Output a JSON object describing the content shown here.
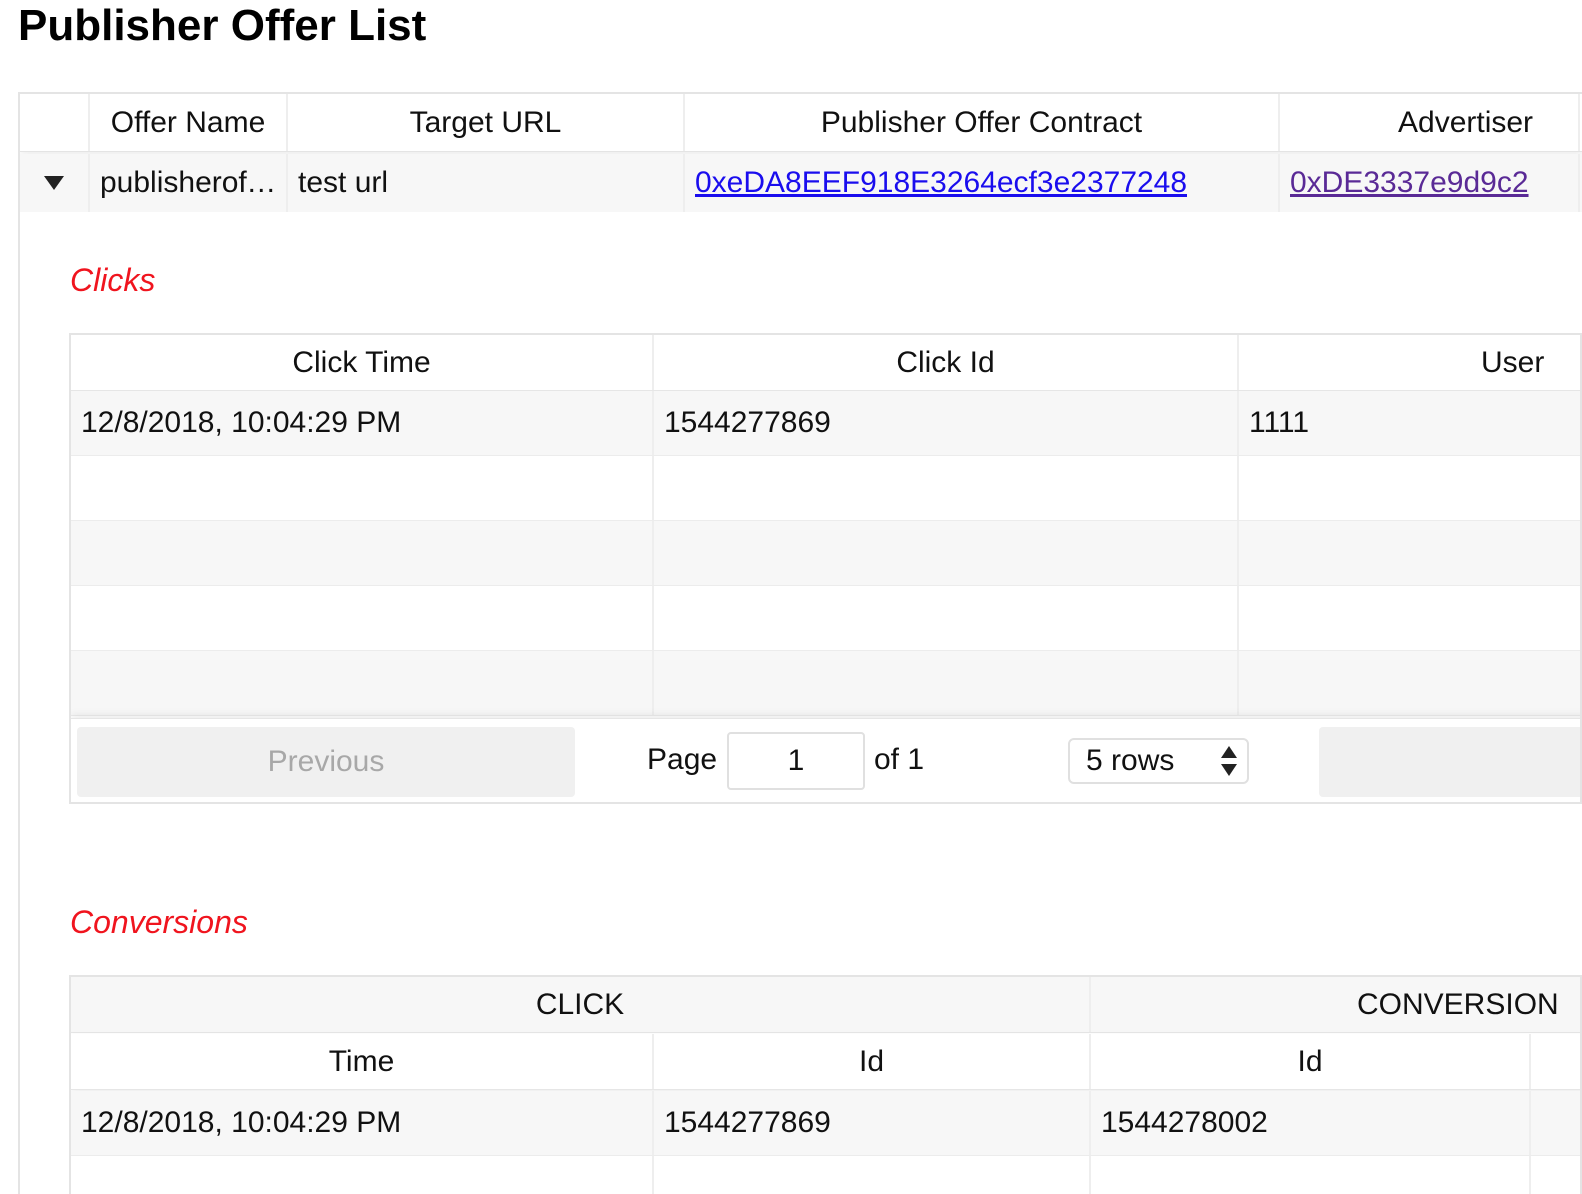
{
  "page": {
    "title": "Publisher Offer List"
  },
  "offers_table": {
    "columns": [
      "",
      "Offer Name",
      "Target URL",
      "Publisher Offer Contract",
      "Advertiser"
    ],
    "rows": [
      {
        "offer_name": "publisheroffer",
        "target_url": "test url",
        "contract": "0xeDA8EEF918E3264ecf3e2377248",
        "advertiser": "0xDE3337e9d9c2"
      }
    ]
  },
  "clicks": {
    "section_title": "Clicks",
    "columns": [
      "Click Time",
      "Click Id",
      "User"
    ],
    "rows": [
      {
        "time": "12/8/2018, 10:04:29 PM",
        "id": "1544277869",
        "user": "1111"
      }
    ],
    "pager": {
      "previous_label": "Previous",
      "page_label": "Page",
      "page_value": "1",
      "of_label": "of 1",
      "rows_option": "5 rows"
    }
  },
  "conversions": {
    "section_title": "Conversions",
    "group_headers": [
      "CLICK",
      "CONVERSION"
    ],
    "columns": [
      "Time",
      "Id",
      "Id"
    ],
    "rows": [
      {
        "click_time": "12/8/2018, 10:04:29 PM",
        "click_id": "1544277869",
        "conversion_id": "1544278002"
      }
    ]
  },
  "colors": {
    "section_label": "#f0141e",
    "link": "#1a0dee",
    "visited_link": "#5a2a96",
    "row_stripe": "#f7f7f7"
  }
}
